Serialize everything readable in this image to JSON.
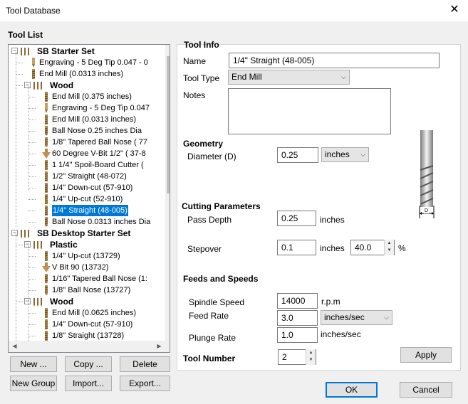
{
  "window": {
    "title": "Tool Database",
    "close_glyph": "✕"
  },
  "tool_list": {
    "label": "Tool List",
    "rows": [
      {
        "text": "SB Starter Set",
        "kind": "group",
        "level": 0,
        "icon": "tool-group-icon"
      },
      {
        "text": "Engraving - 5 Deg Tip 0.047 - 0",
        "kind": "tool",
        "level": 1,
        "icon": "engraving-bit-icon"
      },
      {
        "text": "End Mill (0.0313 inches)",
        "kind": "tool",
        "level": 1,
        "icon": "end-mill-icon"
      },
      {
        "text": "Wood",
        "kind": "group",
        "level": 1,
        "icon": "tool-group-icon"
      },
      {
        "text": "End Mill (0.375 inches)",
        "kind": "tool",
        "level": 2,
        "icon": "end-mill-icon"
      },
      {
        "text": "Engraving - 5 Deg Tip 0.047",
        "kind": "tool",
        "level": 2,
        "icon": "engraving-bit-icon"
      },
      {
        "text": "End Mill (0.0313 inches)",
        "kind": "tool",
        "level": 2,
        "icon": "end-mill-icon"
      },
      {
        "text": "Ball Nose 0.25 inches Dia",
        "kind": "tool",
        "level": 2,
        "icon": "ball-nose-icon"
      },
      {
        "text": "1/8\" Tapered Ball Nose ( 77",
        "kind": "tool",
        "level": 2,
        "icon": "ball-nose-icon"
      },
      {
        "text": "60 Degree V-Bit 1/2\" ( 37-8",
        "kind": "tool",
        "level": 2,
        "icon": "v-bit-icon"
      },
      {
        "text": "1 1/4\" Spoil-Board Cutter (",
        "kind": "tool",
        "level": 2,
        "icon": "end-mill-icon"
      },
      {
        "text": "1/2\" Straight  (48-072)",
        "kind": "tool",
        "level": 2,
        "icon": "end-mill-icon"
      },
      {
        "text": "1/4\"  Down-cut (57-910)",
        "kind": "tool",
        "level": 2,
        "icon": "end-mill-icon"
      },
      {
        "text": "1/4\" Up-cut (52-910)",
        "kind": "tool",
        "level": 2,
        "icon": "end-mill-icon"
      },
      {
        "text": "1/4\" Straight  (48-005)",
        "kind": "tool",
        "level": 2,
        "icon": "end-mill-icon",
        "selected": true
      },
      {
        "text": "Ball Nose 0.0313 inches Dia",
        "kind": "tool",
        "level": 2,
        "icon": "ball-nose-icon"
      },
      {
        "text": "SB Desktop Starter Set",
        "kind": "group",
        "level": 0,
        "icon": "tool-group-icon"
      },
      {
        "text": "Plastic",
        "kind": "group",
        "level": 1,
        "icon": "tool-group-icon"
      },
      {
        "text": "1/4\" Up-cut (13729)",
        "kind": "tool",
        "level": 2,
        "icon": "end-mill-icon"
      },
      {
        "text": "V Bit 90 (13732)",
        "kind": "tool",
        "level": 2,
        "icon": "v-bit-icon"
      },
      {
        "text": "1/16\" Tapered Ball Nose (1:",
        "kind": "tool",
        "level": 2,
        "icon": "ball-nose-icon"
      },
      {
        "text": "1/8\" Ball Nose (13727)",
        "kind": "tool",
        "level": 2,
        "icon": "ball-nose-icon"
      },
      {
        "text": "Wood",
        "kind": "group",
        "level": 1,
        "icon": "tool-group-icon"
      },
      {
        "text": "End Mill (0.0625 inches)",
        "kind": "tool",
        "level": 2,
        "icon": "end-mill-icon"
      },
      {
        "text": "1/4\"  Down-cut (57-910)",
        "kind": "tool",
        "level": 2,
        "icon": "end-mill-icon"
      },
      {
        "text": "1/8\" Straight (13728)",
        "kind": "tool",
        "level": 2,
        "icon": "end-mill-icon"
      }
    ],
    "buttons": {
      "new": "New ...",
      "copy": "Copy ...",
      "delete": "Delete",
      "new_group": "New Group",
      "import": "Import...",
      "export": "Export..."
    }
  },
  "tool_info": {
    "label": "Tool Info",
    "name_label": "Name",
    "name_value": "1/4\" Straight  (48-005)",
    "type_label": "Tool Type",
    "type_value": "End Mill",
    "notes_label": "Notes",
    "notes_value": ""
  },
  "geometry": {
    "label": "Geometry",
    "diameter_label": "Diameter (D)",
    "diameter_value": "0.25",
    "units_value": "inches",
    "diagram_label": "D"
  },
  "cutting": {
    "label": "Cutting Parameters",
    "pass_depth_label": "Pass Depth",
    "pass_depth_value": "0.25",
    "pass_depth_unit": "inches",
    "stepover_label": "Stepover",
    "stepover_value": "0.1",
    "stepover_unit": "inches",
    "stepover_pct_value": "40.0",
    "stepover_pct_unit": "%"
  },
  "feeds": {
    "label": "Feeds and Speeds",
    "spindle_label": "Spindle Speed",
    "spindle_value": "14000",
    "spindle_unit": "r.p.m",
    "feed_label": "Feed Rate",
    "feed_value": "3.0",
    "feed_unit": "inches/sec",
    "plunge_label": "Plunge Rate",
    "plunge_value": "1.0",
    "plunge_unit": "inches/sec"
  },
  "tool_number": {
    "label": "Tool Number",
    "value": "2"
  },
  "actions": {
    "apply": "Apply",
    "ok": "OK",
    "cancel": "Cancel"
  },
  "colors": {
    "selection": "#0078d7",
    "client_bg": "#f0f0f0"
  }
}
